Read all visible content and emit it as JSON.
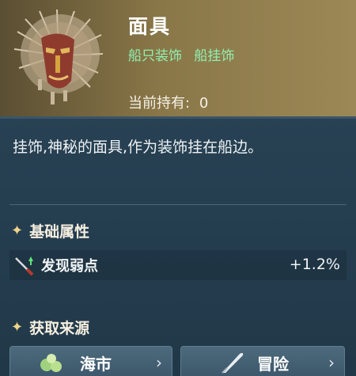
{
  "item": {
    "name": "面具",
    "tags": [
      "船只装饰",
      "船挂饰"
    ],
    "owned_label": "当前持有:",
    "owned_count": "0",
    "image_icon": "tribal-mask-icon"
  },
  "description": "挂饰,神秘的面具,作为装饰挂在船边。",
  "base_attributes": {
    "title": "基础属性",
    "rows": [
      {
        "name": "发现弱点",
        "value": "+1.2%",
        "icon": "spear-icon"
      }
    ]
  },
  "sources": {
    "title": "获取来源",
    "buttons": [
      {
        "label": "海市",
        "icon": "market-goods-icon"
      },
      {
        "label": "冒险",
        "icon": "quill-icon"
      }
    ]
  },
  "colors": {
    "tag_green": "#8ff0b0",
    "header_gold": "#8a7748",
    "panel_blue": "#253e50"
  }
}
